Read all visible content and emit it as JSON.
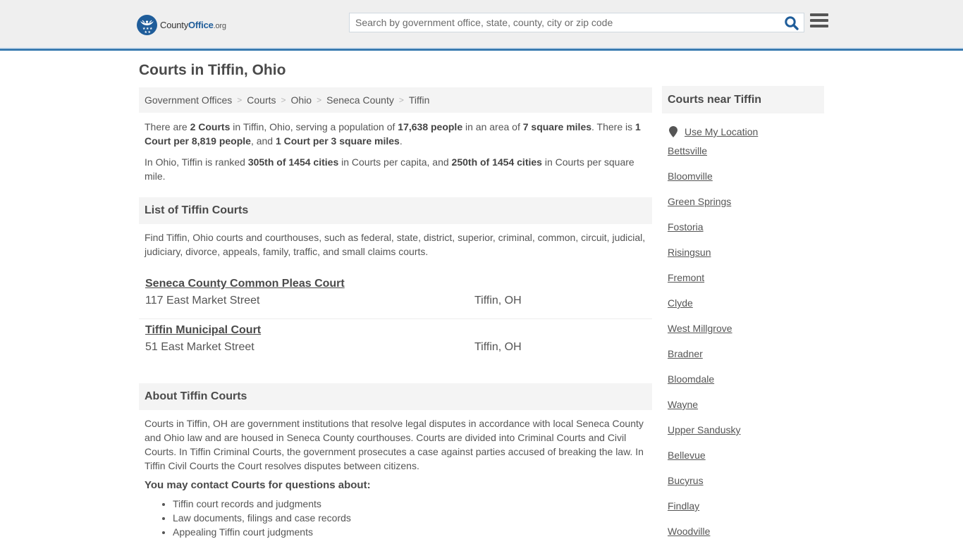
{
  "header": {
    "logo": {
      "brand_plain": "County",
      "brand_bold": "Office",
      "brand_tld": ".org"
    },
    "search": {
      "placeholder": "Search by government office, state, county, city or zip code",
      "value": ""
    },
    "icons": {
      "search": "search-icon",
      "menu": "hamburger-menu-icon",
      "logo": "eagle-stars-seal-icon"
    },
    "accent_color": "#3a7bb0",
    "brand_color": "#1f5d9a"
  },
  "page": {
    "title": "Courts in Tiffin, Ohio"
  },
  "breadcrumb": [
    {
      "label": "Government Offices"
    },
    {
      "label": "Courts"
    },
    {
      "label": "Ohio"
    },
    {
      "label": "Seneca County"
    },
    {
      "label": "Tiffin"
    }
  ],
  "summary": {
    "p1": {
      "t1": "There are ",
      "b1": "2 Courts",
      "t2": " in Tiffin, Ohio, serving a population of ",
      "b2": "17,638 people",
      "t3": " in an area of ",
      "b3": "7 square miles",
      "t4": ". There is ",
      "b4": "1 Court per 8,819 people",
      "t5": ", and ",
      "b5": "1 Court per 3 square miles",
      "t6": "."
    },
    "p2": {
      "t1": "In Ohio, Tiffin is ranked ",
      "b1": "305th of 1454 cities",
      "t2": " in Courts per capita, and ",
      "b2": "250th of 1454 cities",
      "t3": " in Courts per square mile."
    }
  },
  "list_section": {
    "heading": "List of Tiffin Courts",
    "description": "Find Tiffin, Ohio courts and courthouses, such as federal, state, district, superior, criminal, common, circuit, judicial, judiciary, divorce, appeals, family, traffic, and small claims courts.",
    "courts": [
      {
        "name": "Seneca County Common Pleas Court",
        "address": "117 East Market Street",
        "city": "Tiffin, OH"
      },
      {
        "name": "Tiffin Municipal Court",
        "address": "51 East Market Street",
        "city": "Tiffin, OH"
      }
    ]
  },
  "about_section": {
    "heading": "About Tiffin Courts",
    "body": "Courts in Tiffin, OH are government institutions that resolve legal disputes in accordance with local Seneca County and Ohio law and are housed in Seneca County courthouses. Courts are divided into Criminal Courts and Civil Courts. In Tiffin Criminal Courts, the government prosecutes a case against parties accused of breaking the law. In Tiffin Civil Courts the Court resolves disputes between citizens.",
    "contact_heading": "You may contact Courts for questions about:",
    "questions": [
      "Tiffin court records and judgments",
      "Law documents, filings and case records",
      "Appealing Tiffin court judgments"
    ]
  },
  "sidebar": {
    "heading": "Courts near Tiffin",
    "use_location": "Use My Location",
    "location_icon": "map-pin-icon",
    "nearby": [
      "Bettsville",
      "Bloomville",
      "Green Springs",
      "Fostoria",
      "Risingsun",
      "Fremont",
      "Clyde",
      "West Millgrove",
      "Bradner",
      "Bloomdale",
      "Wayne",
      "Upper Sandusky",
      "Bellevue",
      "Bucyrus",
      "Findlay",
      "Woodville"
    ]
  }
}
